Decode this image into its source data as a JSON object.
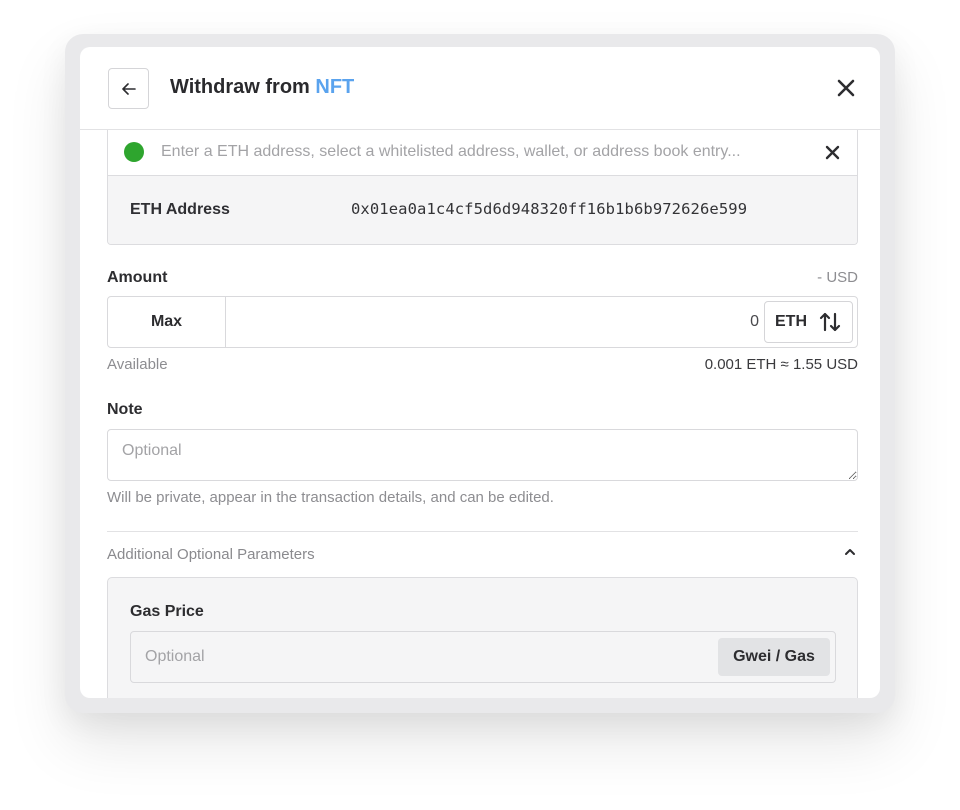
{
  "dialog": {
    "title_prefix": "Withdraw from ",
    "title_accent": "NFT",
    "accent_color": "#5aa3ee",
    "back_icon": "arrow-left-icon",
    "close_icon": "close-icon"
  },
  "address": {
    "placeholder": "Enter a ETH address, select a whitelisted address, wallet, or address book entry...",
    "status_color": "#2ea52e",
    "clear_icon": "close-icon",
    "label": "ETH Address",
    "value": "0x01ea0a1c4cf5d6d948320ff16b1b6b972626e599"
  },
  "amount": {
    "label": "Amount",
    "fiat_equivalent": "- USD",
    "max_label": "Max",
    "value": "0",
    "unit": "ETH",
    "swap_icon": "swap-vertical-icon",
    "available_label": "Available",
    "available_value": "0.001 ETH ≈ 1.55 USD"
  },
  "note": {
    "label": "Note",
    "placeholder": "Optional",
    "help_text": "Will be private, appear in the transaction details, and can be edited."
  },
  "advanced": {
    "toggle_label": "Additional Optional Parameters",
    "expanded": true,
    "gas_price_label": "Gas Price",
    "gas_price_placeholder": "Optional",
    "gas_price_unit": "Gwei / Gas"
  }
}
